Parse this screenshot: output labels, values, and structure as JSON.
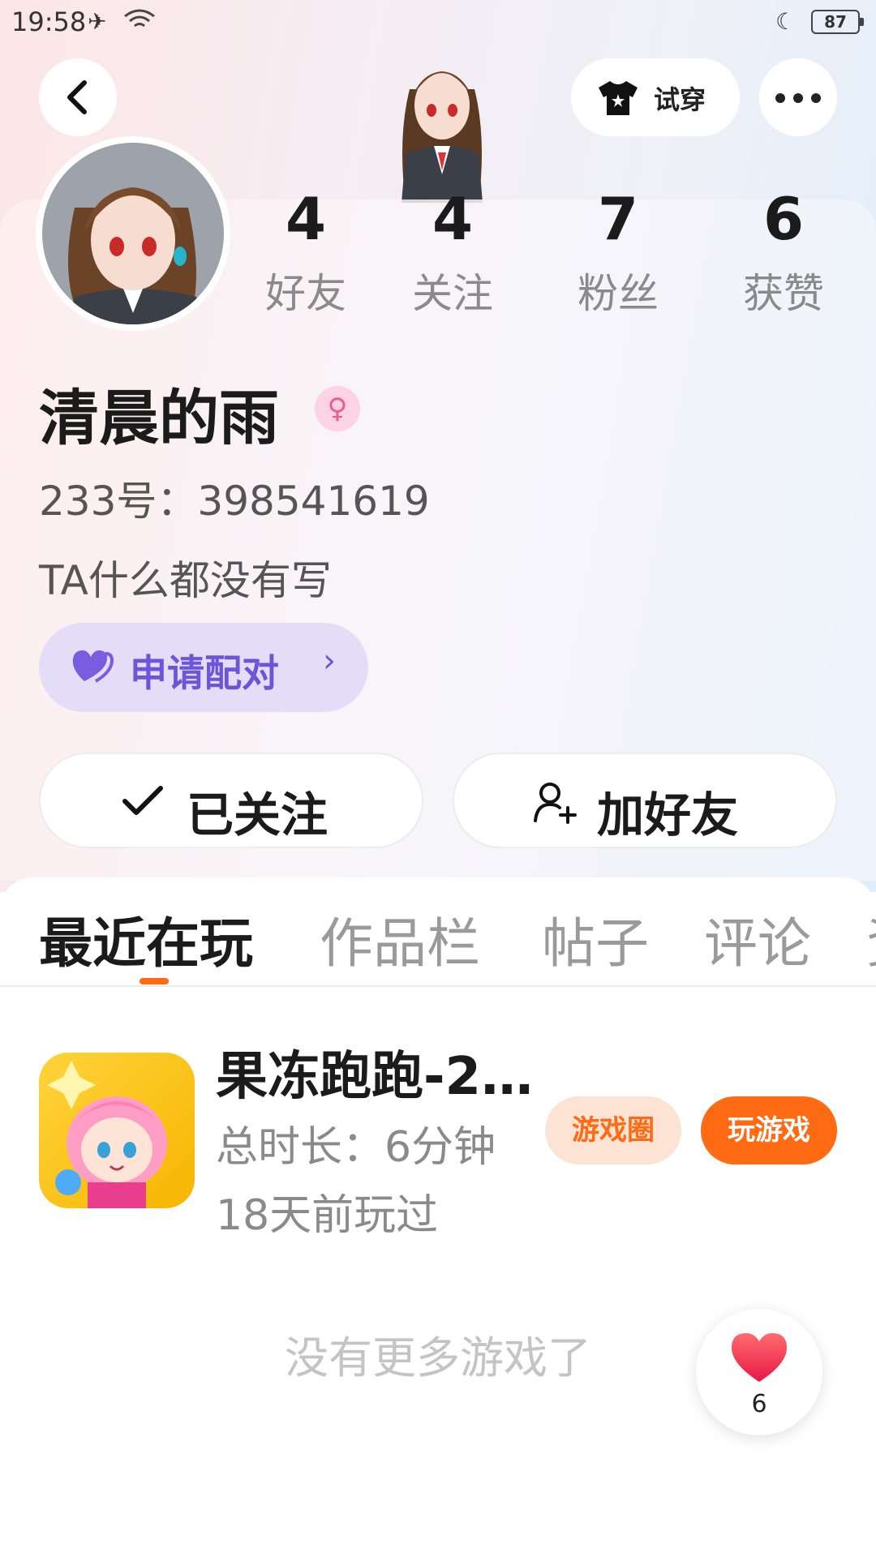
{
  "status_bar": {
    "time": "19:58",
    "battery": "87"
  },
  "header": {
    "tryon_label": "试穿"
  },
  "stats": [
    {
      "value": "4",
      "label": "好友"
    },
    {
      "value": "4",
      "label": "关注"
    },
    {
      "value": "7",
      "label": "粉丝"
    },
    {
      "value": "6",
      "label": "获赞"
    }
  ],
  "profile": {
    "nickname": "清晨的雨",
    "gender_symbol": "♀",
    "uid": "233号：398541619",
    "bio": "TA什么都没有写",
    "pair_label": "申请配对",
    "pair_chevron": "›",
    "followed_label": "已关注",
    "add_friend_label": "加好友"
  },
  "tabs": [
    "最近在玩",
    "作品栏",
    "帖子",
    "评论",
    "资"
  ],
  "game": {
    "title": "果冻跑跑-2…",
    "total_time": "总时长：6分钟",
    "last_played": "18天前玩过",
    "circle_label": "游戏圈",
    "play_label": "玩游戏"
  },
  "footer": {
    "no_more": "没有更多游戏了",
    "like_count": "6"
  },
  "colors": {
    "accent": "#ff6a13",
    "pair": "#6b55d8"
  }
}
